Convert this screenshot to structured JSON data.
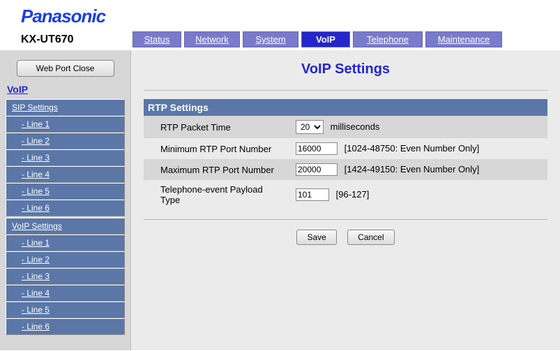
{
  "brand": "Panasonic",
  "model": "KX-UT670",
  "tabs": {
    "status": "Status",
    "network": "Network",
    "system": "System",
    "voip": "VoIP",
    "telephone": "Telephone",
    "maintenance": "Maintenance"
  },
  "active_tab": "voip",
  "sidebar": {
    "close_button": "Web Port Close",
    "title": "VoIP",
    "groups": [
      {
        "head": "SIP Settings",
        "items": [
          "- Line 1",
          "- Line 2",
          "- Line 3",
          "- Line 4",
          "- Line 5",
          "- Line 6"
        ]
      },
      {
        "head": "VoIP Settings",
        "items": [
          "- Line 1",
          "- Line 2",
          "- Line 3",
          "- Line 4",
          "- Line 5",
          "- Line 6"
        ]
      }
    ]
  },
  "main": {
    "title": "VoIP Settings",
    "section_head": "RTP Settings",
    "rows": {
      "packet_time": {
        "label": "RTP Packet Time",
        "value": "20",
        "unit": "milliseconds"
      },
      "min_port": {
        "label": "Minimum RTP Port Number",
        "value": "16000",
        "hint": "[1024-48750: Even Number Only]"
      },
      "max_port": {
        "label": "Maximum RTP Port Number",
        "value": "20000",
        "hint": "[1424-49150: Even Number Only]"
      },
      "payload": {
        "label": "Telephone-event Payload Type",
        "value": "101",
        "hint": "[96-127]"
      }
    },
    "buttons": {
      "save": "Save",
      "cancel": "Cancel"
    }
  }
}
